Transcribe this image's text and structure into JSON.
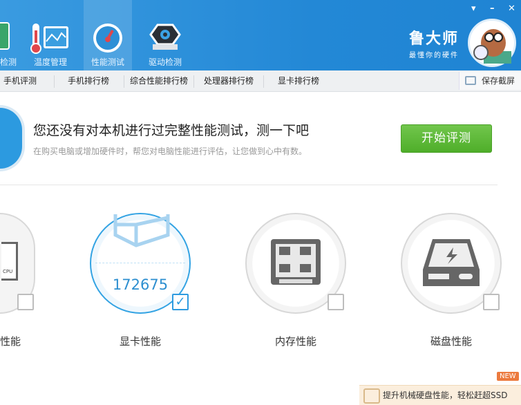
{
  "header": {
    "nav": [
      {
        "label": "检测"
      },
      {
        "label": "温度管理"
      },
      {
        "label": "性能测试"
      },
      {
        "label": "驱动检测"
      }
    ],
    "brand": "鲁大师",
    "slogan": "最懂你的硬件",
    "window_controls": [
      "menu",
      "minimize",
      "close"
    ]
  },
  "tabs": {
    "items": [
      "手机评测",
      "手机排行榜",
      "综合性能排行榜",
      "处理器排行榜",
      "显卡排行榜"
    ],
    "screenshot": "保存截屏"
  },
  "banner": {
    "title": "您还没有对本机进行过完整性能测试，测一下吧",
    "subtitle": "在购买电脑或增加硬件时，帮您对电脑性能进行评估，让您做到心中有数。",
    "start_button": "开始评测"
  },
  "cards": [
    {
      "label": "性能",
      "checked": false
    },
    {
      "label": "显卡性能",
      "score": "172675",
      "checked": true
    },
    {
      "label": "内存性能",
      "checked": false
    },
    {
      "label": "磁盘性能",
      "checked": false
    }
  ],
  "promo": {
    "text": "提升机械硬盘性能，轻松赶超SSD",
    "badge": "NEW"
  },
  "colors": {
    "header": "#2388d6",
    "accent": "#33a3e3",
    "green": "#5bb534"
  }
}
